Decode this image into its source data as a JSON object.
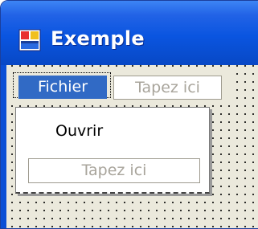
{
  "window": {
    "title": "Exemple",
    "icon": "windows-form-icon",
    "colors": {
      "titlebar": "#0a55e0",
      "title_text": "#ffffff",
      "client": "#ebe9dc",
      "selection": "#316ac5"
    }
  },
  "menubar": {
    "items": [
      {
        "label": "Fichier",
        "selected": true
      }
    ],
    "type_here_placeholder": "Tapez ici"
  },
  "dropdown": {
    "items": [
      {
        "label": "Ouvrir"
      }
    ],
    "type_here_placeholder": "Tapez ici"
  }
}
